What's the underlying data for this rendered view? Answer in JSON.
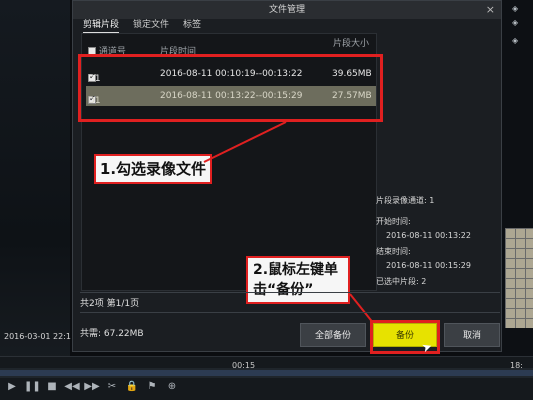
{
  "dialog": {
    "title": "文件管理",
    "tabs": [
      "剪辑片段",
      "锁定文件",
      "标签"
    ],
    "list_header": {
      "channel": "通道号",
      "time": "片段时间",
      "size": "片段大小"
    },
    "rows": [
      {
        "channel": "D1",
        "time": "2016-08-11 00:10:19--00:13:22",
        "size": "39.65MB",
        "checked": true
      },
      {
        "channel": "D1",
        "time": "2016-08-11 00:13:22--00:15:29",
        "size": "27.57MB",
        "checked": true
      }
    ],
    "info": {
      "clip_channel": "片段录像通道: 1",
      "start_label": "开始时间:",
      "start_value": "2016-08-11 00:13:22",
      "end_label": "结束时间:",
      "end_value": "2016-08-11 00:15:29",
      "selected_count": "已选中片段: 2"
    },
    "pagination": "共2项 第1/1页",
    "total_size": "共需: 67.22MB",
    "buttons": {
      "backup_all": "全部备份",
      "backup": "备份",
      "cancel": "取消"
    }
  },
  "callouts": {
    "step1": "1.勾选录像文件",
    "step2_line1": "2.鼠标左键单",
    "step2_line2": "击“备份”"
  },
  "timeline": {
    "date": "2016-03-01 22:1",
    "labels": [
      "00:15",
      "18:"
    ],
    "controls_icons": [
      "play-icon",
      "pause-icon",
      "stop-icon",
      "rewind-icon",
      "forward-icon",
      "clip-icon",
      "lock-icon",
      "tag-icon",
      "zoom-icon"
    ]
  },
  "colors": {
    "highlight": "#e02020",
    "primary_button": "#e7e200",
    "selected_row": "#6d6d5d"
  }
}
